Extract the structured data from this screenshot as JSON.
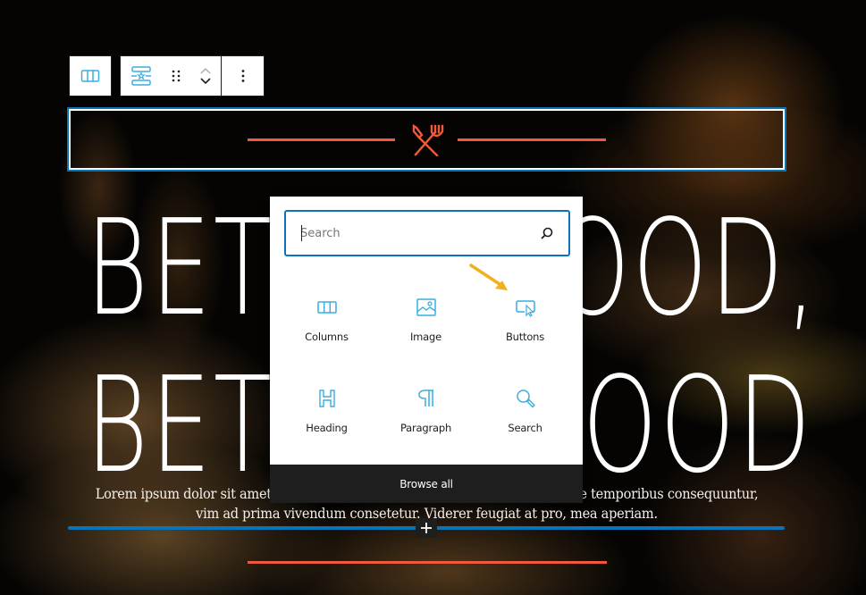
{
  "toolbar": {
    "block_type_icon": "columns-icon",
    "transform_icon": "separator-block-icon",
    "drag_icon": "drag-handle-icon",
    "move_up_icon": "chevron-up-icon",
    "move_down_icon": "chevron-down-icon",
    "more_options_icon": "more-vertical-icon"
  },
  "separator": {
    "icon": "knife-fork-icon",
    "accent_color": "#f05a3c"
  },
  "hero": {
    "title_line1": "BETTER FOOD,",
    "title_line2": "BETTER MOOD",
    "paragraph": "Lorem ipsum dolor sit amet, at mei dolore tritani repudiandae. In his nemore temporibus consequuntur, vim ad prima vivendum consetetur. Viderer feugiat at pro, mea aperiam."
  },
  "inserter": {
    "search": {
      "value": "",
      "placeholder": "Search",
      "icon": "search-icon"
    },
    "blocks": [
      {
        "label": "Columns",
        "icon": "columns-icon"
      },
      {
        "label": "Image",
        "icon": "image-icon"
      },
      {
        "label": "Buttons",
        "icon": "buttons-icon"
      },
      {
        "label": "Heading",
        "icon": "heading-icon"
      },
      {
        "label": "Paragraph",
        "icon": "paragraph-icon"
      },
      {
        "label": "Search",
        "icon": "search-icon"
      }
    ],
    "browse_all_label": "Browse all",
    "accent_color": "#0a74b8"
  },
  "insertion_point": {
    "plus_label": "+"
  },
  "annotation": {
    "arrow_color": "#f0b020",
    "points_to": "Buttons"
  }
}
